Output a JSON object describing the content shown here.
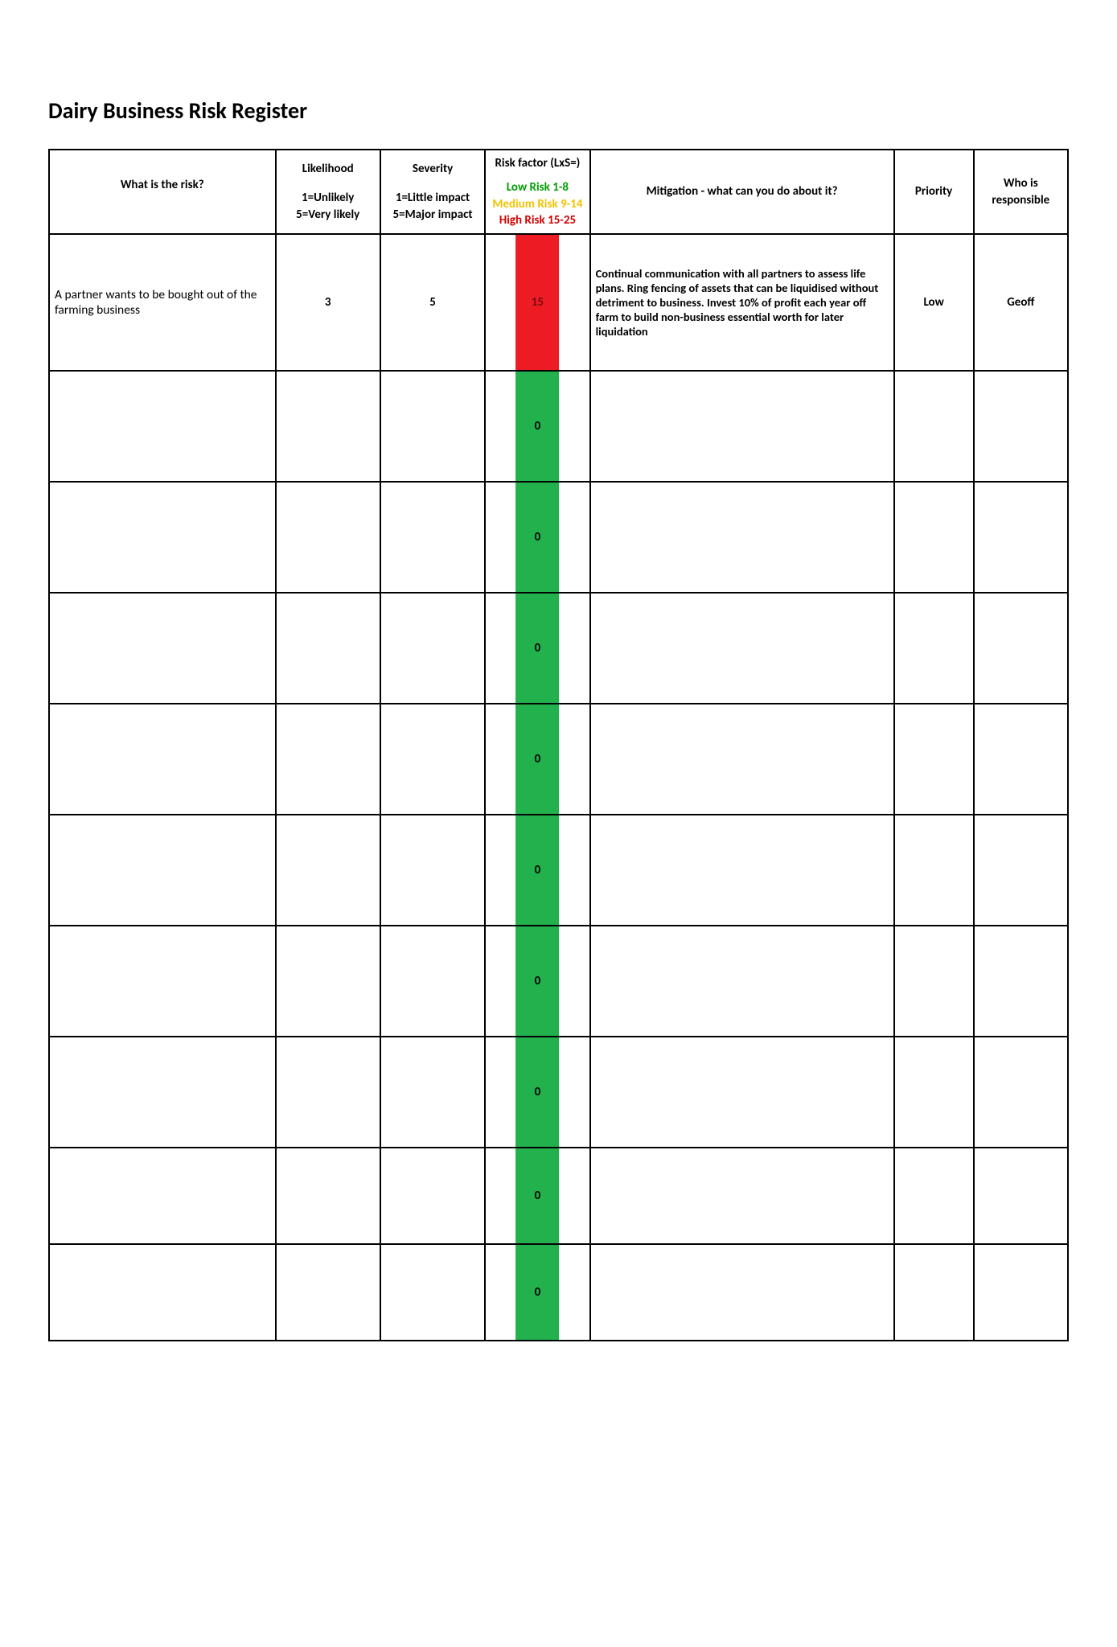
{
  "title": "Dairy Business Risk Register",
  "headers": {
    "risk": "What is the risk?",
    "likelihood_main": "Likelihood",
    "likelihood_sub1": "1=Unlikely",
    "likelihood_sub2": "5=Very likely",
    "severity_main": "Severity",
    "severity_sub1": "1=Little impact",
    "severity_sub2": "5=Major impact",
    "riskfactor_main": "Risk factor (LxS=)",
    "riskfactor_low": "Low Risk 1-8",
    "riskfactor_med": "Medium Risk 9-14",
    "riskfactor_high": "High Risk 15-25",
    "mitigation": "Mitigation - what can you do about it?",
    "priority": "Priority",
    "responsible": "Who is responsible"
  },
  "rows": [
    {
      "risk": "A partner wants to be bought out of the farming business",
      "likelihood": "3",
      "severity": "5",
      "risk_factor": "15",
      "risk_band": "red",
      "mitigation": "Continual communication with all partners to assess life plans. Ring fencing of assets that can be liquidised without detriment to business. Invest 10% of profit each year off farm to build non-business essential worth for later liquidation",
      "priority": "Low",
      "responsible": "Geoff"
    },
    {
      "risk": "",
      "likelihood": "",
      "severity": "",
      "risk_factor": "0",
      "risk_band": "green",
      "mitigation": "",
      "priority": "",
      "responsible": ""
    },
    {
      "risk": "",
      "likelihood": "",
      "severity": "",
      "risk_factor": "0",
      "risk_band": "green",
      "mitigation": "",
      "priority": "",
      "responsible": ""
    },
    {
      "risk": "",
      "likelihood": "",
      "severity": "",
      "risk_factor": "0",
      "risk_band": "green",
      "mitigation": "",
      "priority": "",
      "responsible": ""
    },
    {
      "risk": "",
      "likelihood": "",
      "severity": "",
      "risk_factor": "0",
      "risk_band": "green",
      "mitigation": "",
      "priority": "",
      "responsible": ""
    },
    {
      "risk": "",
      "likelihood": "",
      "severity": "",
      "risk_factor": "0",
      "risk_band": "green",
      "mitigation": "",
      "priority": "",
      "responsible": ""
    },
    {
      "risk": "",
      "likelihood": "",
      "severity": "",
      "risk_factor": "0",
      "risk_band": "green",
      "mitigation": "",
      "priority": "",
      "responsible": ""
    },
    {
      "risk": "",
      "likelihood": "",
      "severity": "",
      "risk_factor": "0",
      "risk_band": "green",
      "mitigation": "",
      "priority": "",
      "responsible": ""
    },
    {
      "risk": "",
      "likelihood": "",
      "severity": "",
      "risk_factor": "0",
      "risk_band": "green",
      "mitigation": "",
      "priority": "",
      "responsible": ""
    },
    {
      "risk": "",
      "likelihood": "",
      "severity": "",
      "risk_factor": "0",
      "risk_band": "green",
      "mitigation": "",
      "priority": "",
      "responsible": ""
    }
  ]
}
